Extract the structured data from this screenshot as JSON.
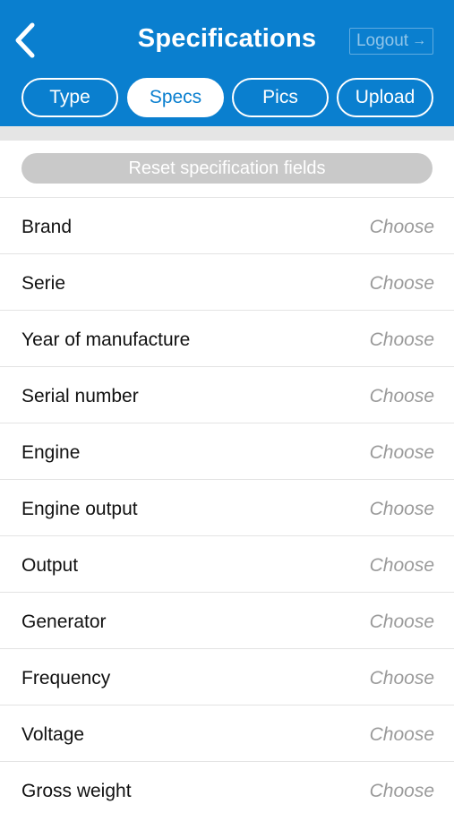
{
  "header": {
    "title": "Specifications",
    "logout_label": "Logout",
    "logout_icon": "arrow-right-icon",
    "back_icon": "chevron-left-icon",
    "background_color": "#0a7fcf"
  },
  "tabs": [
    {
      "label": "Type",
      "active": false
    },
    {
      "label": "Specs",
      "active": true
    },
    {
      "label": "Pics",
      "active": false
    },
    {
      "label": "Upload",
      "active": false
    }
  ],
  "reset_label": "Reset specification fields",
  "fields": [
    {
      "label": "Brand",
      "value": "Choose"
    },
    {
      "label": "Serie",
      "value": "Choose"
    },
    {
      "label": "Year of manufacture",
      "value": "Choose"
    },
    {
      "label": "Serial number",
      "value": "Choose"
    },
    {
      "label": "Engine",
      "value": "Choose"
    },
    {
      "label": "Engine output",
      "value": "Choose"
    },
    {
      "label": "Output",
      "value": "Choose"
    },
    {
      "label": "Generator",
      "value": "Choose"
    },
    {
      "label": "Frequency",
      "value": "Choose"
    },
    {
      "label": "Voltage",
      "value": "Choose"
    },
    {
      "label": "Gross weight",
      "value": "Choose"
    }
  ]
}
